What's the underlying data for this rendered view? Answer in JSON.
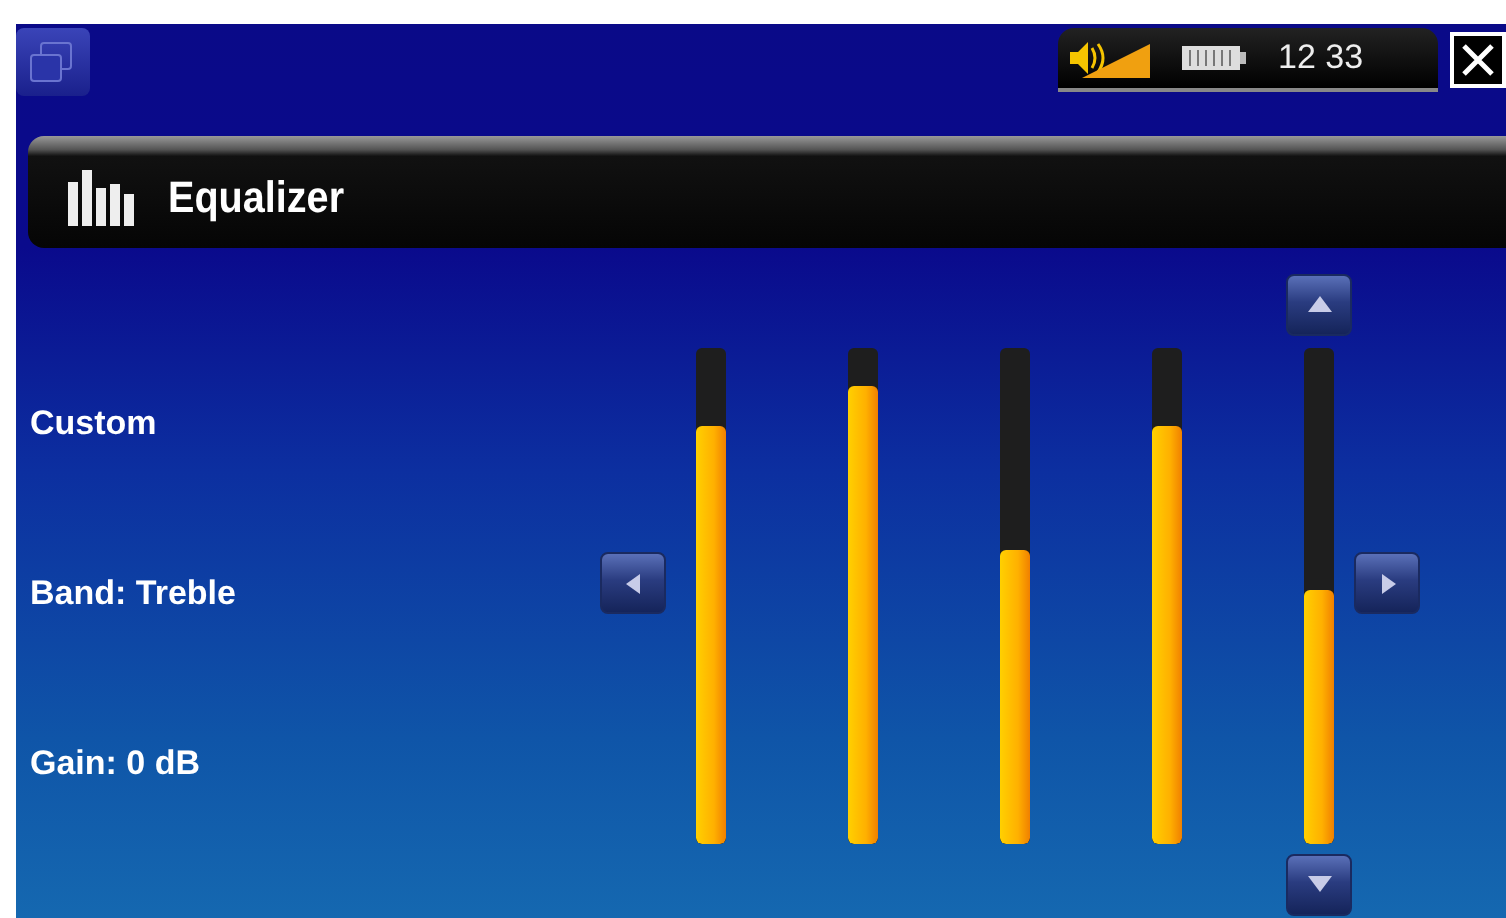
{
  "status_bar": {
    "time": "12 33"
  },
  "header": {
    "title": "Equalizer"
  },
  "info": [
    "Custom",
    "Band: Treble",
    "Gain: 0 dB"
  ],
  "bands": [
    {
      "level": 0.84
    },
    {
      "level": 0.92
    },
    {
      "level": 0.59
    },
    {
      "level": 0.84
    },
    {
      "level": 0.51
    }
  ]
}
